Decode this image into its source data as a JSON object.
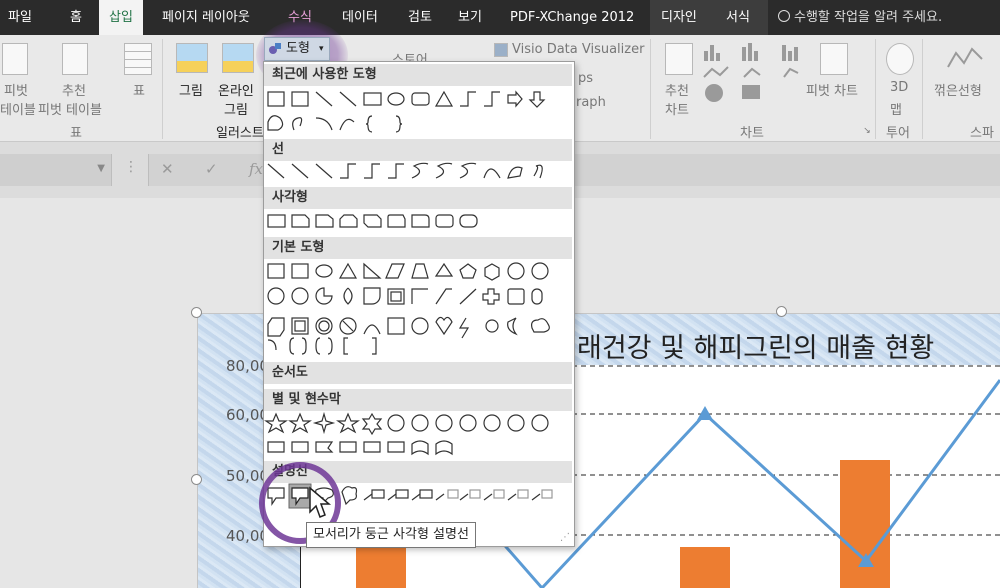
{
  "menu": {
    "tabs": [
      "파일",
      "홈",
      "삽입",
      "페이지 레이아웃",
      "수식",
      "데이터",
      "검토",
      "보기",
      "PDF-XChange 2012"
    ],
    "context_tabs": [
      "디자인",
      "서식"
    ],
    "tell_me": "수행할 작업을 알려 주세요."
  },
  "ribbon": {
    "pivot_label1": "피벗",
    "pivot_label2": "테이블",
    "recommended_pivot1": "추천",
    "recommended_pivot2": "피벗 테이블",
    "table_label": "표",
    "group_table": "표",
    "picture": "그림",
    "online_picture1": "온라인",
    "online_picture2": "그림",
    "group_illustration": "일러스트",
    "store": "스토어",
    "visio": "Visio Data Visualizer",
    "maps_fragment": "ps",
    "graph_fragment": "raph",
    "recommended_chart1": "추천",
    "recommended_chart2": "차트",
    "group_chart": "차트",
    "pivot_chart": "피벗 차트",
    "map3d_1": "3D",
    "map3d_2": "맵",
    "group_tour": "투어",
    "sparkline_line": "꺾은선형",
    "group_sparkline": "스파"
  },
  "formula": {
    "fx": "fx"
  },
  "shapes": {
    "button": "도형",
    "categories": [
      "최근에 사용한 도형",
      "선",
      "사각형",
      "기본 도형",
      "순서도",
      "별 및 현수막",
      "설명선"
    ],
    "tooltip": "모서리가 둥근 사각형 설명선"
  },
  "chart": {
    "title": "래건강 및 해피그린의 매출 현황",
    "y_ticks": [
      "80,00",
      "60,00",
      "50,00",
      "40,00"
    ]
  },
  "chart_data": {
    "type": "bar",
    "title": "래건강 및 해피그린의 매출 현황",
    "y_ticks": [
      "80,00",
      "60,00",
      "50,00",
      "40,00"
    ],
    "series": [
      {
        "type": "bar",
        "color": "#ed7d31",
        "values": [
          30000,
          33000,
          55000
        ]
      },
      {
        "type": "line",
        "color": "#5b9bd5",
        "values": [
          28000,
          64000,
          36000,
          82000
        ]
      }
    ],
    "ylim": [
      30000,
      88000
    ],
    "grid": true
  },
  "colors": {
    "accent": "#217346",
    "bar": "#ed7d31",
    "line": "#5b9bd5",
    "ring": "#6e3796"
  }
}
